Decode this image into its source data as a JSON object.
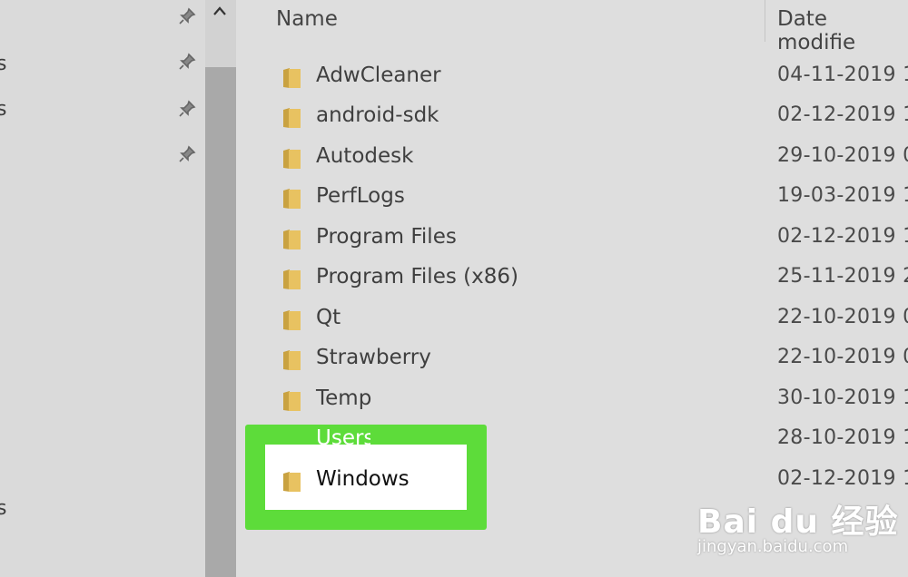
{
  "nav": {
    "labels": [
      "s",
      "s",
      "s"
    ]
  },
  "list": {
    "columns": {
      "name": "Name",
      "date": "Date modifie"
    },
    "rows": [
      {
        "name": "AdwCleaner",
        "date": "04-11-2019 1"
      },
      {
        "name": "android-sdk",
        "date": "02-12-2019 1"
      },
      {
        "name": "Autodesk",
        "date": "29-10-2019 0"
      },
      {
        "name": "PerfLogs",
        "date": "19-03-2019 1"
      },
      {
        "name": "Program Files",
        "date": "02-12-2019 1"
      },
      {
        "name": "Program Files (x86)",
        "date": "25-11-2019 2"
      },
      {
        "name": "Qt",
        "date": "22-10-2019 0"
      },
      {
        "name": "Strawberry",
        "date": "22-10-2019 0"
      },
      {
        "name": "Temp",
        "date": "30-10-2019 1"
      },
      {
        "name": "Users",
        "date": "28-10-2019 1"
      },
      {
        "name": "Windows",
        "date": "02-12-2019 1"
      }
    ]
  },
  "highlight": {
    "color": "#5ddc3a",
    "target": "Windows"
  },
  "watermark": {
    "logo": "Bai du 经验",
    "url": "jingyan.baidu.com"
  },
  "colors": {
    "folder": "#e8c261",
    "folder_dark": "#c9a241"
  }
}
